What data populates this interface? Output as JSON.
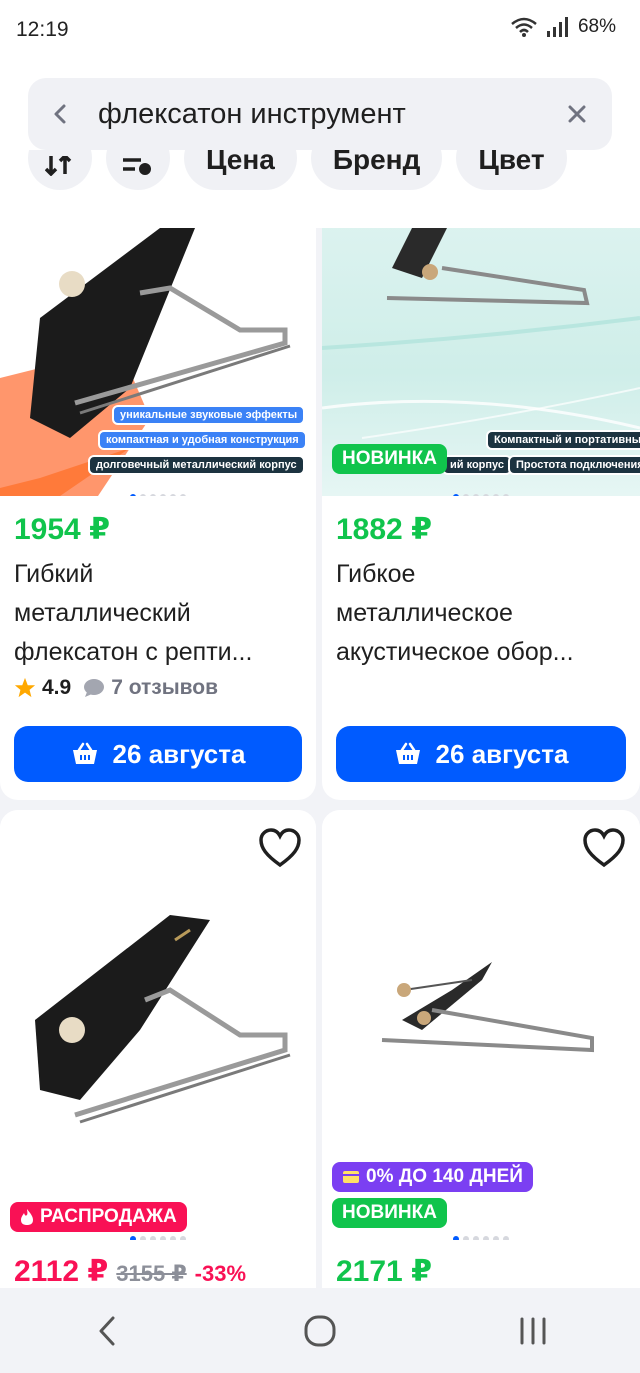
{
  "status_bar": {
    "time": "12:19",
    "battery": "68%"
  },
  "search": {
    "query": "флексатон инструмент"
  },
  "filters": {
    "price": "Цена",
    "brand": "Бренд",
    "color": "Цвет"
  },
  "products": [
    {
      "price": "1954 ₽",
      "title_lines": [
        "Гибкий",
        "металлический",
        "флексатон с репти..."
      ],
      "rating": "4.9",
      "reviews": "7 отзывов",
      "cart_label": "26 августа",
      "promo_tags": [
        "уникальные звуковые эффекты",
        "компактная и удобная конструкция",
        "долговечный металлический корпус"
      ]
    },
    {
      "price": "1882 ₽",
      "title_lines": [
        "Гибкое",
        "металлическое",
        "акустическое обор..."
      ],
      "badge_new": "НОВИНКА",
      "cart_label": "26 августа",
      "promo_tags": [
        "Компактный и портативный",
        "ий корпус",
        "Простота подключения"
      ]
    },
    {
      "price": "2112 ₽",
      "old_price": "3155 ₽",
      "discount": "-33%",
      "badge_sale": "РАСПРОДАЖА"
    },
    {
      "price": "2171 ₽",
      "badge_installment": "0% ДО 140 ДНЕЙ",
      "badge_new": "НОВИНКА"
    }
  ],
  "colors": {
    "accent": "#005bff",
    "price_green": "#10c44c",
    "sale_pink": "#f91155",
    "installment_purple": "#7b3ff2"
  }
}
